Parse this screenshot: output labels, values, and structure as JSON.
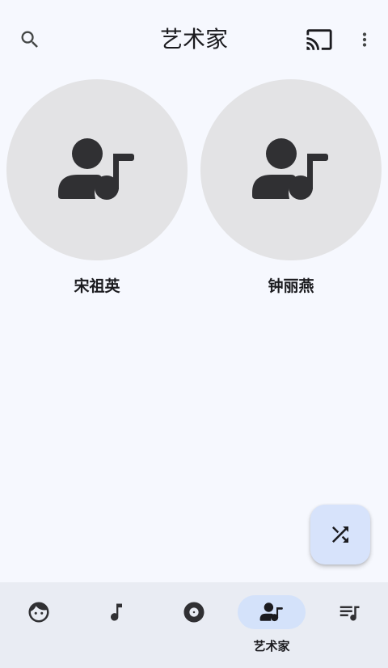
{
  "header": {
    "title": "艺术家"
  },
  "icons": {
    "search": "search-icon",
    "cast": "cast-icon",
    "more": "more-vert-icon",
    "artist": "artist-music-icon",
    "shuffle": "shuffle-icon"
  },
  "artists": [
    {
      "name": "宋祖英"
    },
    {
      "name": "钟丽燕"
    }
  ],
  "fab": {
    "icon": "shuffle-icon"
  },
  "nav": {
    "items": [
      {
        "icon": "face-icon",
        "label": "",
        "active": false
      },
      {
        "icon": "music-note-icon",
        "label": "",
        "active": false
      },
      {
        "icon": "album-icon",
        "label": "",
        "active": false
      },
      {
        "icon": "artist-music-icon",
        "label": "艺术家",
        "active": true
      },
      {
        "icon": "playlist-icon",
        "label": "",
        "active": false
      }
    ]
  },
  "colors": {
    "background": "#f6f8fe",
    "nav_background": "#e9ecf3",
    "active_pill": "#d4e2fa",
    "fab": "#d7e3fb",
    "artwork_placeholder": "#e3e3e5",
    "icon": "#303033"
  }
}
